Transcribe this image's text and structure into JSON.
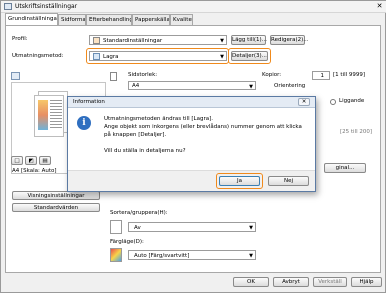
{
  "window": {
    "title": "Utskriftsinställningar"
  },
  "tabs": [
    "Grundinställningar",
    "Sidformat",
    "Efterbehandling",
    "Papperskälla",
    "Kvalitet"
  ],
  "profile": {
    "label": "Profil:",
    "value": "Standardinställningar",
    "add_button": "Lägg till(1)...",
    "edit_button": "Redigera(2)..."
  },
  "output_method": {
    "label": "Utmatningsmetod:",
    "value": "Lagra",
    "details_button": "Detaljer(3)..."
  },
  "page_size": {
    "label": "Sidstorlek:",
    "value": "A4"
  },
  "copies": {
    "label": "Kopior:",
    "value": "1",
    "range": "[1 till 9999]"
  },
  "orientation": {
    "label": "Orientering",
    "landscape": "Liggande"
  },
  "partial_range": "[25 till 200]",
  "preview_caption": "A4 [Skala: Auto]",
  "manual_button_partial": "ginal...",
  "left_buttons": {
    "printer_settings": "Visningsinställningar",
    "defaults": "Standardvärden"
  },
  "sort": {
    "label": "Sortera/gruppera(H):",
    "value": "Av"
  },
  "color": {
    "label": "Färgläge(D):",
    "value": "Auto [Färg/svartvitt]"
  },
  "footer": {
    "ok": "OK",
    "cancel": "Avbryt",
    "apply": "Verkställ",
    "help": "Hjälp"
  },
  "dialog": {
    "title": "Information",
    "line1": "Utmatningsmetoden ändras till [Lagra].",
    "line2": "Ange objekt som inkorgens (eller brevlådans) nummer genom att klicka",
    "line3": "på knappen [Detaljer].",
    "line4": "Vill du ställa in detaljerna nu?",
    "yes": "Ja",
    "no": "Nej"
  },
  "colors": {
    "accent_ring": "#f08a1c",
    "dialog_border": "#5b7aa3",
    "info_icon": "#2f6fc0"
  }
}
